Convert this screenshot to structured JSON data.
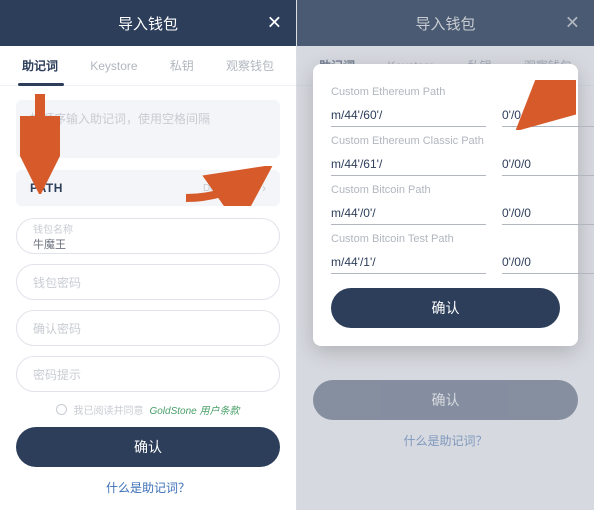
{
  "header": {
    "title": "导入钱包",
    "close_glyph": "✕"
  },
  "tabs": {
    "mnemonic": "助记词",
    "keystore": "Keystore",
    "private_key": "私钥",
    "watch": "观察钱包"
  },
  "left": {
    "mnemonic_placeholder": "按顺序输入助记词，使用空格间隔",
    "path_label": "PATH",
    "default_path": "Default Path",
    "chevron": "›",
    "wallet_name_label": "钱包名称",
    "wallet_name_value": "牛魔王",
    "wallet_pwd_label": "钱包密码",
    "confirm_pwd_label": "确认密码",
    "pwd_hint_label": "密码提示",
    "agree_text": "我已阅读并同意",
    "terms_link": "GoldStone 用户条款",
    "confirm": "确认",
    "help_link": "什么是助记词？"
  },
  "modal": {
    "groups": [
      {
        "label": "Custom Ethereum Path",
        "prefix": "m/44'/60'/",
        "suffix": "0'/0/0"
      },
      {
        "label": "Custom Ethereum Classic Path",
        "prefix": "m/44'/61'/",
        "suffix": "0'/0/0"
      },
      {
        "label": "Custom Bitcoin Path",
        "prefix": "m/44'/0'/",
        "suffix": "0'/0/0"
      },
      {
        "label": "Custom Bitcoin Test Path",
        "prefix": "m/44'/1'/",
        "suffix": "0'/0/0"
      }
    ],
    "confirm": "确认"
  },
  "right": {
    "confirm": "确认",
    "help_link": "什么是助记词？"
  }
}
